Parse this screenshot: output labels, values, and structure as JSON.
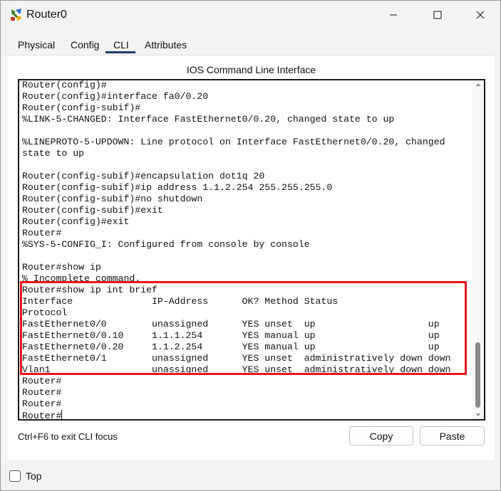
{
  "window": {
    "title": "Router0",
    "icon": "router-icon",
    "controls": {
      "minimize": "minimize-icon",
      "maximize": "maximize-icon",
      "close": "close-icon"
    }
  },
  "tabs": [
    {
      "label": "Physical",
      "active": false
    },
    {
      "label": "Config",
      "active": false
    },
    {
      "label": "CLI",
      "active": true
    },
    {
      "label": "Attributes",
      "active": false
    }
  ],
  "panel": {
    "title": "IOS Command Line Interface"
  },
  "terminal": {
    "lines": [
      "Router(config)#",
      "Router(config)#interface fa0/0.20",
      "Router(config-subif)#",
      "%LINK-5-CHANGED: Interface FastEthernet0/0.20, changed state to up",
      "",
      "%LINEPROTO-5-UPDOWN: Line protocol on Interface FastEthernet0/0.20, changed",
      "state to up",
      "",
      "Router(config-subif)#encapsulation dot1q 20",
      "Router(config-subif)#ip address 1.1.2.254 255.255.255.0",
      "Router(config-subif)#no shutdown",
      "Router(config-subif)#exit",
      "Router(config)#exit",
      "Router#",
      "%SYS-5-CONFIG_I: Configured from console by console",
      "",
      "Router#show ip",
      "% Incomplete command.",
      "Router#show ip int brief",
      "Interface              IP-Address      OK? Method Status",
      "Protocol",
      "FastEthernet0/0        unassigned      YES unset  up                    up",
      "FastEthernet0/0.10     1.1.1.254       YES manual up                    up",
      "FastEthernet0/0.20     1.1.2.254       YES manual up                    up",
      "FastEthernet0/1        unassigned      YES unset  administratively down down",
      "Vlan1                  unassigned      YES unset  administratively down down",
      "Router#",
      "Router#",
      "Router#",
      "Router#"
    ],
    "highlight_color": "#e8161c"
  },
  "hint": "Ctrl+F6 to exit CLI focus",
  "buttons": {
    "copy": "Copy",
    "paste": "Paste"
  },
  "footer": {
    "top_label": "Top",
    "top_checked": false
  }
}
